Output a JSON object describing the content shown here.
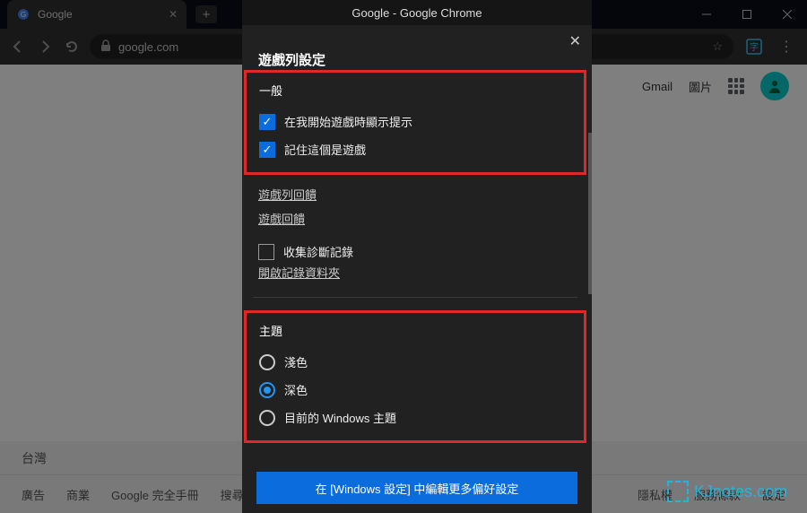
{
  "window": {
    "title": "Google - Google Chrome"
  },
  "tab": {
    "title": "Google"
  },
  "urlbar": {
    "text": "google.com"
  },
  "page": {
    "links": {
      "gmail": "Gmail",
      "images": "圖片"
    },
    "location": "台灣",
    "footer": {
      "ad": "廣告",
      "business": "商業",
      "about": "Google 完全手冊",
      "search": "搜尋服務",
      "privacy": "隱私權",
      "terms": "服務條款",
      "settings": "設定"
    }
  },
  "modal": {
    "heading": "遊戲列設定",
    "sections": {
      "general": {
        "title": "一般",
        "opt1": "在我開始遊戲時顯示提示",
        "opt2": "記住這個是遊戲"
      },
      "feedback1": "遊戲列回饋",
      "feedback2": "遊戲回饋",
      "diag": {
        "collect": "收集診斷記錄",
        "open": "開啟記錄資料夾"
      },
      "theme": {
        "title": "主題",
        "light": "淺色",
        "dark": "深色",
        "windows": "目前的 Windows 主題"
      }
    },
    "footer_button": "在 [Windows 設定] 中編輯更多偏好設定"
  },
  "watermark": "KJnotes.com"
}
